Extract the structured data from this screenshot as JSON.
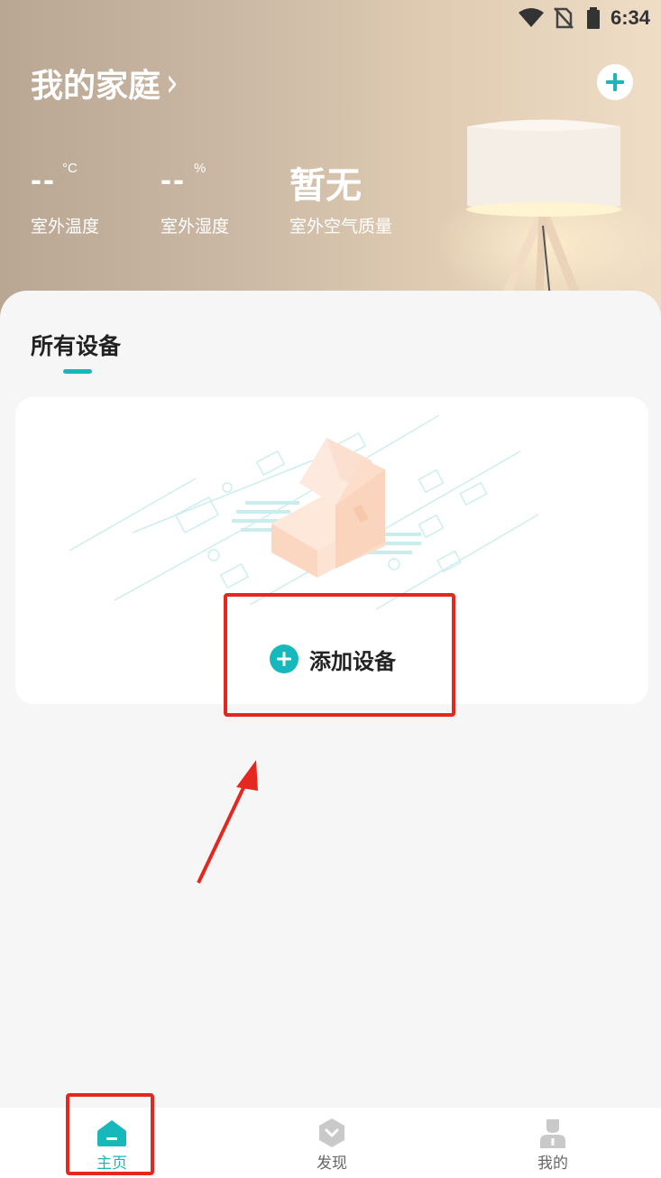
{
  "status_bar": {
    "time": "6:34"
  },
  "header": {
    "home_name": "我的家庭",
    "chevron": "›",
    "add_icon": "plus-icon",
    "metrics": [
      {
        "value": "--",
        "unit": "°C",
        "label": "室外温度"
      },
      {
        "value": "--",
        "unit": "%",
        "label": "室外湿度"
      },
      {
        "value": "暂无",
        "unit": "",
        "label": "室外空气质量"
      }
    ]
  },
  "devices": {
    "section_title": "所有设备",
    "add_device_label": "添加设备"
  },
  "tabbar": {
    "items": [
      {
        "label": "主页",
        "icon": "home-icon",
        "active": true
      },
      {
        "label": "发现",
        "icon": "discover-icon",
        "active": false
      },
      {
        "label": "我的",
        "icon": "profile-icon",
        "active": false
      }
    ]
  },
  "colors": {
    "accent": "#17b8bc",
    "highlight": "#e5281f"
  }
}
